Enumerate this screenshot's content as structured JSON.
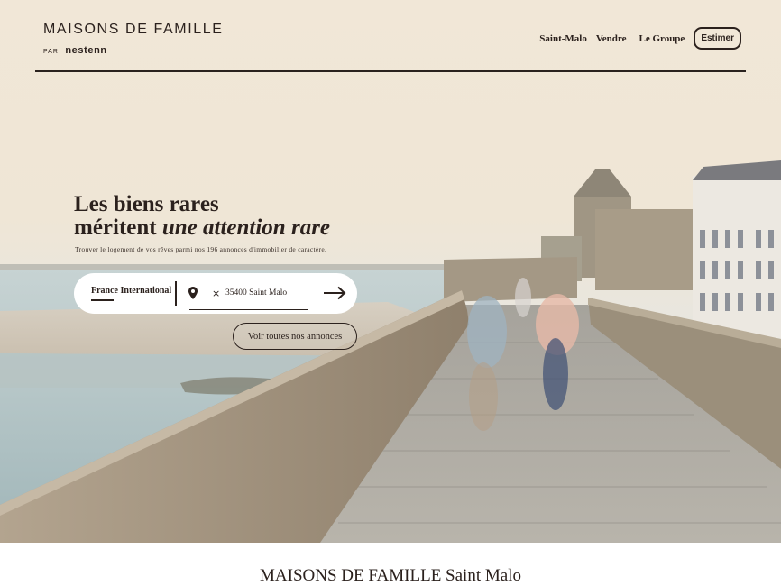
{
  "brand": {
    "name": "MAISONS DE FAMILLE",
    "par": "PAR",
    "network": "nestenn"
  },
  "nav": {
    "items": [
      "Saint-Malo",
      "Vendre",
      "Le Groupe"
    ],
    "cta": "Estimer"
  },
  "hero": {
    "headline_line1": "Les biens rares",
    "headline_line2_plain": "méritent ",
    "headline_line2_italic": "une attention rare",
    "subline": "Trouver le logement de vos rêves parmi nos 196 annonces d'immobilier de caractère."
  },
  "search": {
    "scope": "France International",
    "location_chip": "35400 Saint Malo",
    "icons": {
      "location": "map-pin-icon",
      "remove": "close-icon",
      "submit": "arrow-right-icon"
    }
  },
  "cta_all": "Voir toutes nos annonces",
  "agency": {
    "title": "MAISONS DE FAMILLE Saint Malo"
  },
  "colors": {
    "text": "#2b211d",
    "cream": "#f1e7d7",
    "stone": "#a79784",
    "sea": "#aabcbf"
  }
}
